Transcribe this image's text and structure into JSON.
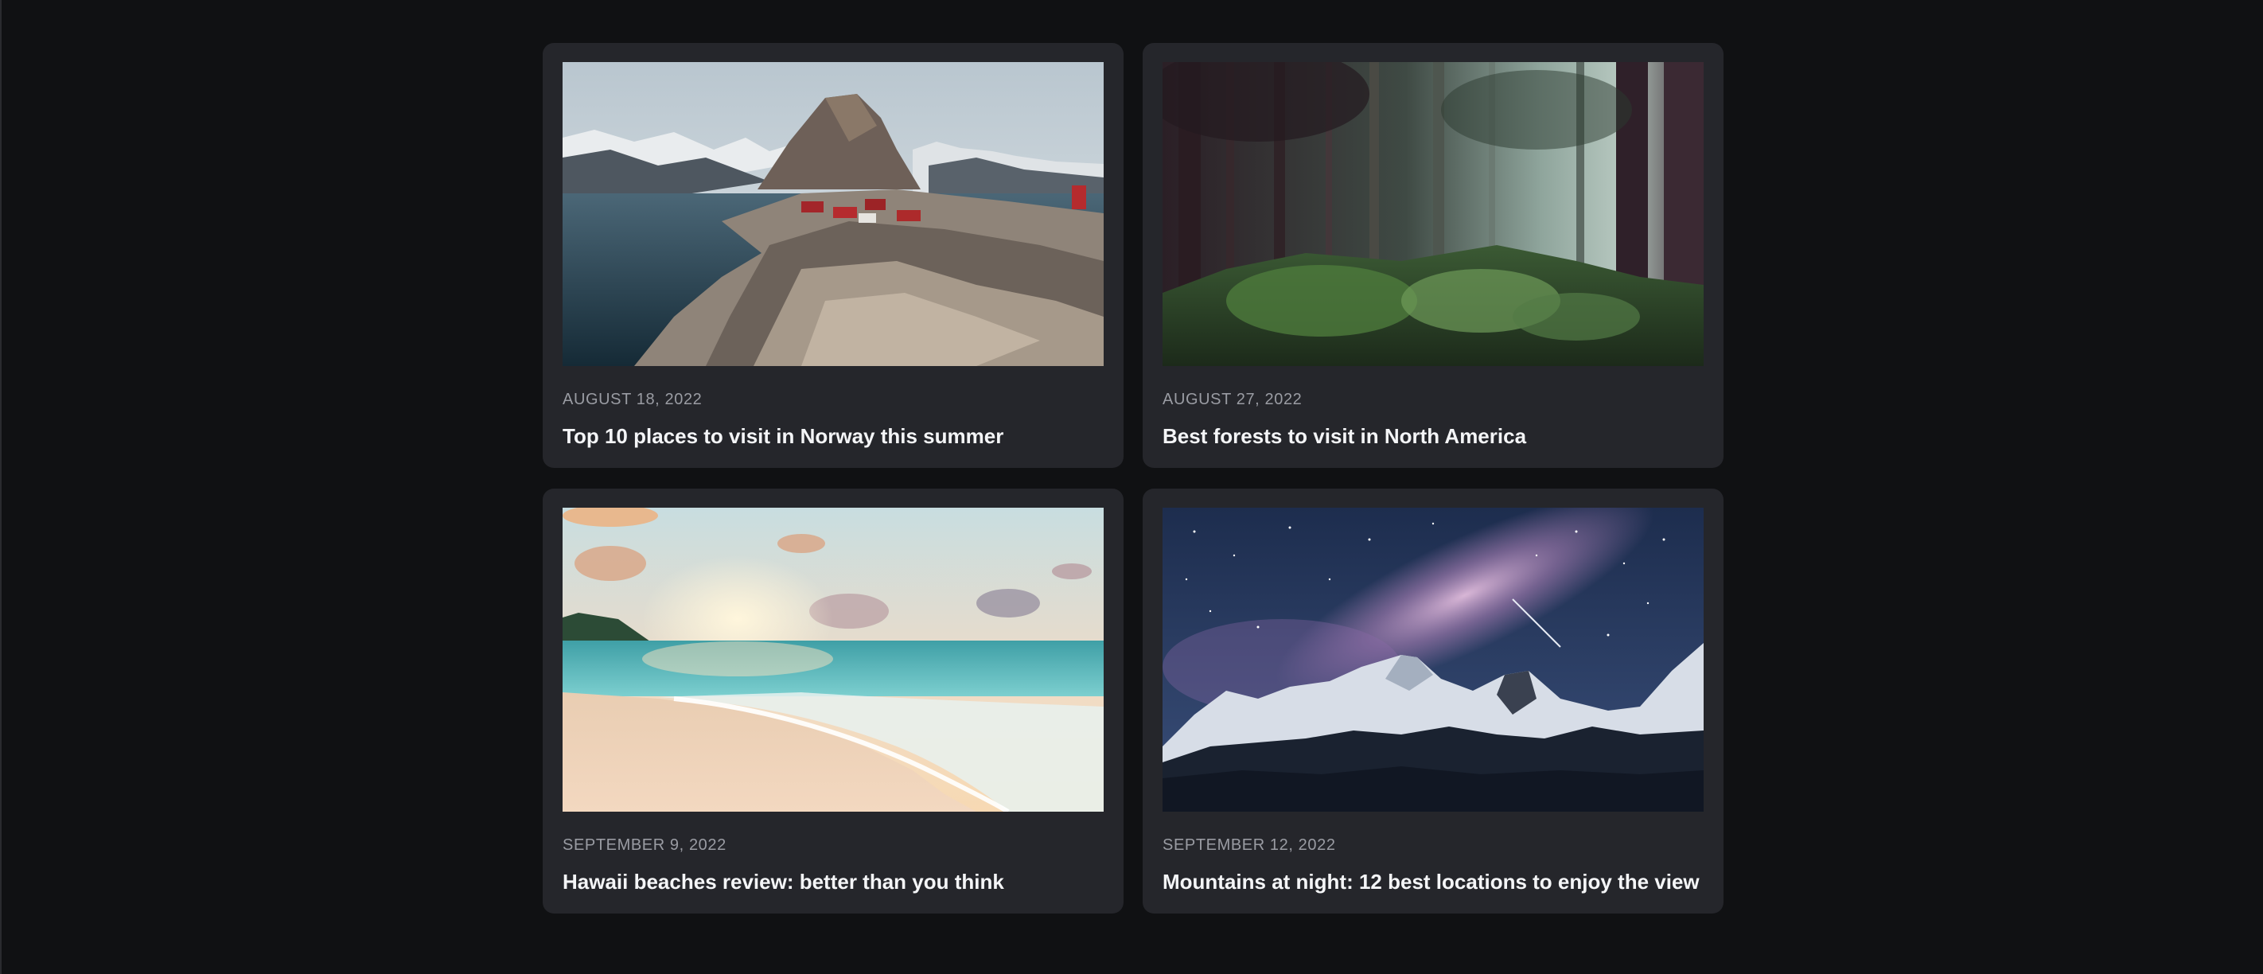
{
  "articles": [
    {
      "date": "AUGUST 18, 2022",
      "title": "Top 10 places to visit in Norway this summer",
      "image": "norway-fjord-village-photo"
    },
    {
      "date": "AUGUST 27, 2022",
      "title": "Best forests to visit in North America",
      "image": "misty-forest-photo"
    },
    {
      "date": "SEPTEMBER 9, 2022",
      "title": "Hawaii beaches review: better than you think",
      "image": "beach-sunset-photo"
    },
    {
      "date": "SEPTEMBER 12, 2022",
      "title": "Mountains at night: 12 best locations to enjoy the view",
      "image": "milky-way-mountains-photo"
    }
  ],
  "colors": {
    "background": "#101113",
    "card": "#25262b",
    "date_text": "#9a9ca3",
    "title_text": "#f4f5f7"
  }
}
